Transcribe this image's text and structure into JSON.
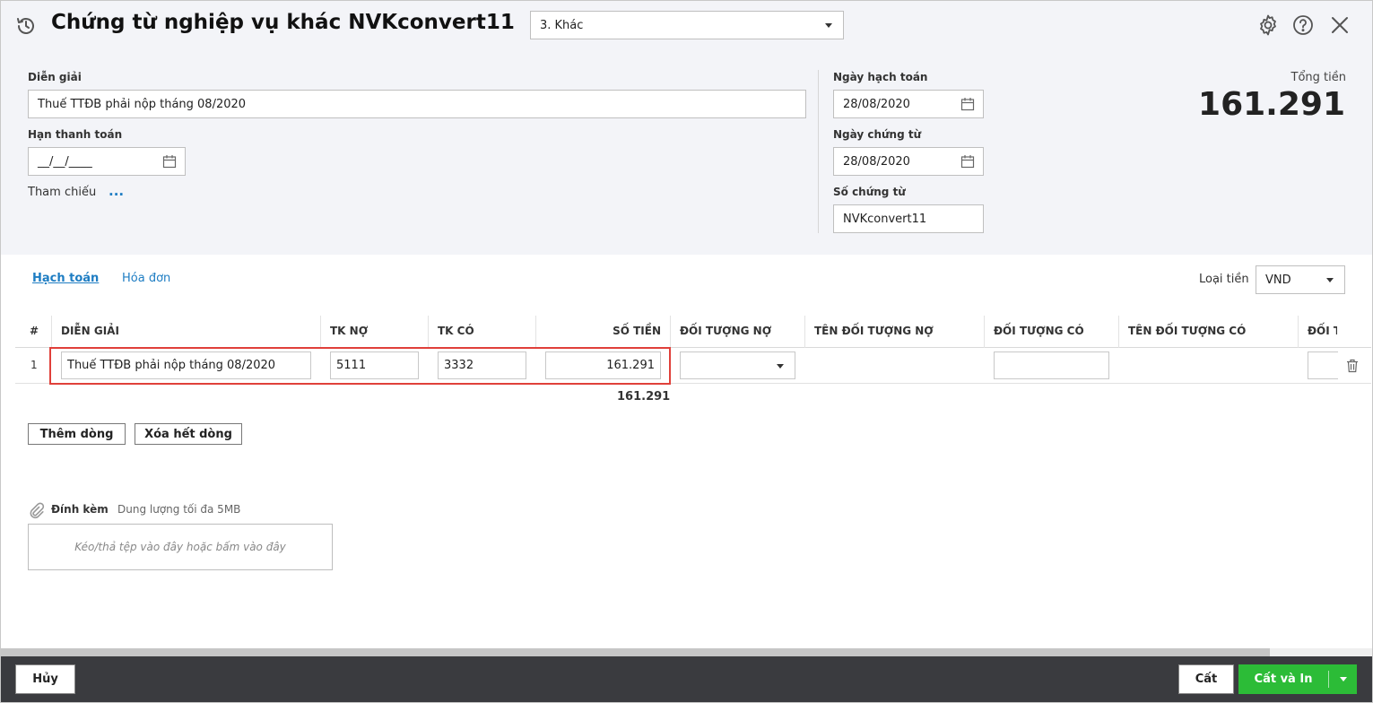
{
  "header": {
    "title": "Chứng từ nghiệp vụ khác NVKconvert11",
    "type_select": "3. Khác"
  },
  "form": {
    "dien_giai_label": "Diễn giải",
    "dien_giai_value": "Thuế TTĐB phải nộp tháng 08/2020",
    "han_tt_label": "Hạn thanh toán",
    "han_tt_value": "__/__/____",
    "tham_chieu_label": "Tham chiếu",
    "tham_chieu_link": "...",
    "ngay_hach_toan_label": "Ngày hạch toán",
    "ngay_hach_toan_value": "28/08/2020",
    "ngay_chung_tu_label": "Ngày chứng từ",
    "ngay_chung_tu_value": "28/08/2020",
    "so_chung_tu_label": "Số chứng từ",
    "so_chung_tu_value": "NVKconvert11"
  },
  "total": {
    "label": "Tổng tiền",
    "value": "161.291"
  },
  "tabs": [
    {
      "label": "Hạch toán",
      "active": true
    },
    {
      "label": "Hóa đơn",
      "active": false
    }
  ],
  "currency": {
    "label": "Loại tiền",
    "value": "VND"
  },
  "grid": {
    "columns": [
      "#",
      "DIỄN GIẢI",
      "TK NỢ",
      "TK CÓ",
      "SỐ TIỀN",
      "ĐỐI TƯỢNG NỢ",
      "TÊN ĐỐI TƯỢNG NỢ",
      "ĐỐI TƯỢNG CÓ",
      "TÊN ĐỐI TƯỢNG CÓ",
      "ĐỐI T"
    ],
    "rows": [
      {
        "no": "1",
        "dien_giai": "Thuế TTĐB phải nộp tháng 08/2020",
        "tk_no": "5111",
        "tk_co": "3332",
        "so_tien": "161.291",
        "doi_tuong_no": "",
        "doi_tuong_co": ""
      }
    ],
    "sum": "161.291"
  },
  "actions": {
    "add_row": "Thêm dòng",
    "clear_rows": "Xóa hết dòng"
  },
  "attach": {
    "label": "Đính kèm",
    "hint": "Dung lượng tối đa 5MB",
    "dropzone": "Kéo/thả tệp vào đây hoặc bấm vào đây"
  },
  "footer": {
    "cancel": "Hủy",
    "save": "Cất",
    "save_print": "Cất và In"
  },
  "icons": [
    "history-icon",
    "gear-icon",
    "help-icon",
    "close-icon",
    "calendar-icon",
    "trash-icon",
    "paperclip-icon",
    "chevron-down-icon"
  ]
}
